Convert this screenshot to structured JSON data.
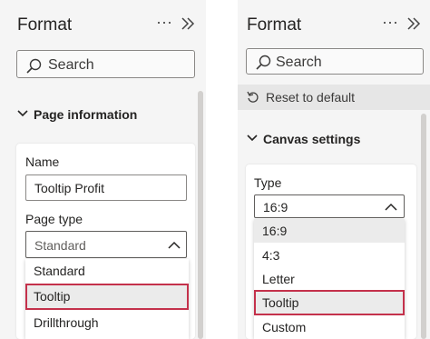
{
  "left": {
    "title": "Format",
    "more_icon": "more-options-icon",
    "collapse_icon": "collapse-pane-icon",
    "search": {
      "placeholder": "Search"
    },
    "section": {
      "label": "Page information"
    },
    "name_field": {
      "label": "Name",
      "value": "Tooltip Profit"
    },
    "page_type": {
      "label": "Page type",
      "selected": "Standard",
      "options": [
        "Standard",
        "Tooltip",
        "Drillthrough"
      ],
      "highlighted": "Tooltip"
    }
  },
  "right": {
    "title": "Format",
    "more_icon": "more-options-icon",
    "collapse_icon": "collapse-pane-icon",
    "search": {
      "placeholder": "Search"
    },
    "reset_label": "Reset to default",
    "section": {
      "label": "Canvas settings"
    },
    "type_field": {
      "label": "Type",
      "selected": "16:9",
      "options": [
        "16:9",
        "4:3",
        "Letter",
        "Tooltip",
        "Custom"
      ],
      "highlighted": "Tooltip"
    }
  },
  "colors": {
    "highlight_outline": "#c4314b",
    "panel_bg": "#f5f5f5"
  }
}
